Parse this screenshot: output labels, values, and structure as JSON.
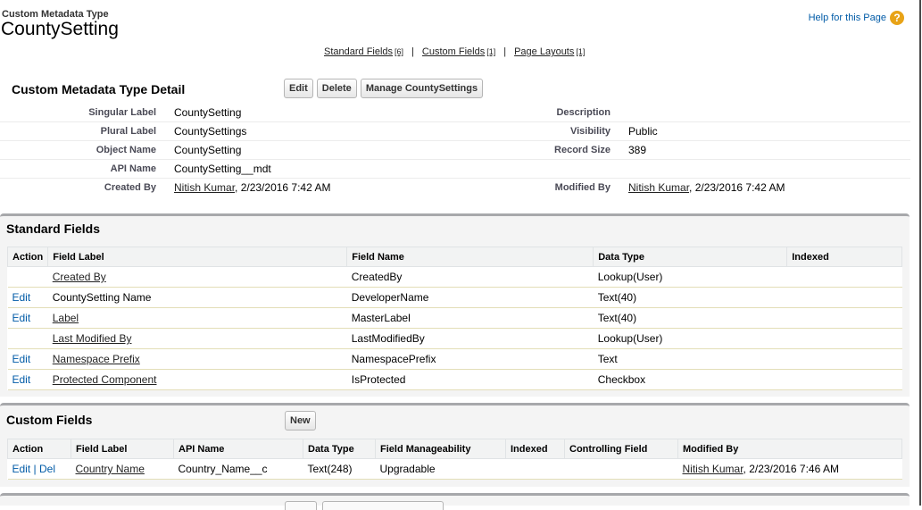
{
  "header": {
    "type_label": "Custom Metadata Type",
    "name": "CountySetting",
    "help_link": "Help for this Page",
    "help_icon": "question-mark-icon"
  },
  "quicklinks": [
    {
      "label": "Standard Fields",
      "count": "[6]"
    },
    {
      "label": "Custom Fields",
      "count": "[1]"
    },
    {
      "label": "Page Layouts",
      "count": "[1]"
    }
  ],
  "quicklinks_separator": "|",
  "detail": {
    "title": "Custom Metadata Type Detail",
    "buttons": {
      "edit": "Edit",
      "delete": "Delete",
      "manage": "Manage CountySettings"
    },
    "rows": [
      {
        "l1": "Singular Label",
        "v1": "CountySetting",
        "l2": "Description",
        "v2": ""
      },
      {
        "l1": "Plural Label",
        "v1": "CountySettings",
        "l2": "Visibility",
        "v2": "Public"
      },
      {
        "l1": "Object Name",
        "v1": "CountySetting",
        "l2": "Record Size",
        "v2": "389"
      },
      {
        "l1": "API Name",
        "v1": "CountySetting__mdt",
        "l2": "",
        "v2": ""
      },
      {
        "l1": "Created By",
        "v1_user": "Nitish Kumar",
        "v1_date": ", 2/23/2016 7:42 AM",
        "l2": "Modified By",
        "v2_user": "Nitish Kumar",
        "v2_date": ", 2/23/2016 7:42 AM"
      }
    ]
  },
  "standard_fields": {
    "title": "Standard Fields",
    "columns": [
      "Action",
      "Field Label",
      "Field Name",
      "Data Type",
      "Indexed"
    ],
    "rows": [
      {
        "action": "",
        "label": "Created By",
        "label_link": true,
        "name": "CreatedBy",
        "type": "Lookup(User)",
        "indexed": ""
      },
      {
        "action": "Edit",
        "label": "CountySetting Name",
        "label_link": false,
        "name": "DeveloperName",
        "type": "Text(40)",
        "indexed": ""
      },
      {
        "action": "Edit",
        "label": "Label",
        "label_link": true,
        "name": "MasterLabel",
        "type": "Text(40)",
        "indexed": ""
      },
      {
        "action": "",
        "label": "Last Modified By",
        "label_link": true,
        "name": "LastModifiedBy",
        "type": "Lookup(User)",
        "indexed": ""
      },
      {
        "action": "Edit",
        "label": "Namespace Prefix",
        "label_link": true,
        "name": "NamespacePrefix",
        "type": "Text",
        "indexed": ""
      },
      {
        "action": "Edit",
        "label": "Protected Component",
        "label_link": true,
        "name": "IsProtected",
        "type": "Checkbox",
        "indexed": ""
      }
    ]
  },
  "custom_fields": {
    "title": "Custom Fields",
    "new_button": "New",
    "columns": [
      "Action",
      "Field Label",
      "API Name",
      "Data Type",
      "Field Manageability",
      "Indexed",
      "Controlling Field",
      "Modified By"
    ],
    "rows": [
      {
        "edit": "Edit",
        "sep": "|",
        "del": "Del",
        "label": "Country Name",
        "api": "Country_Name__c",
        "type": "Text(248)",
        "manage": "Upgradable",
        "indexed": "",
        "controlling": "",
        "mod_user": "Nitish Kumar",
        "mod_date": ", 2/23/2016 7:46 AM"
      }
    ]
  },
  "colors": {
    "link_blue": "#015ba7",
    "section_border": "#a7a8ab",
    "help_orange": "#e8a317"
  }
}
